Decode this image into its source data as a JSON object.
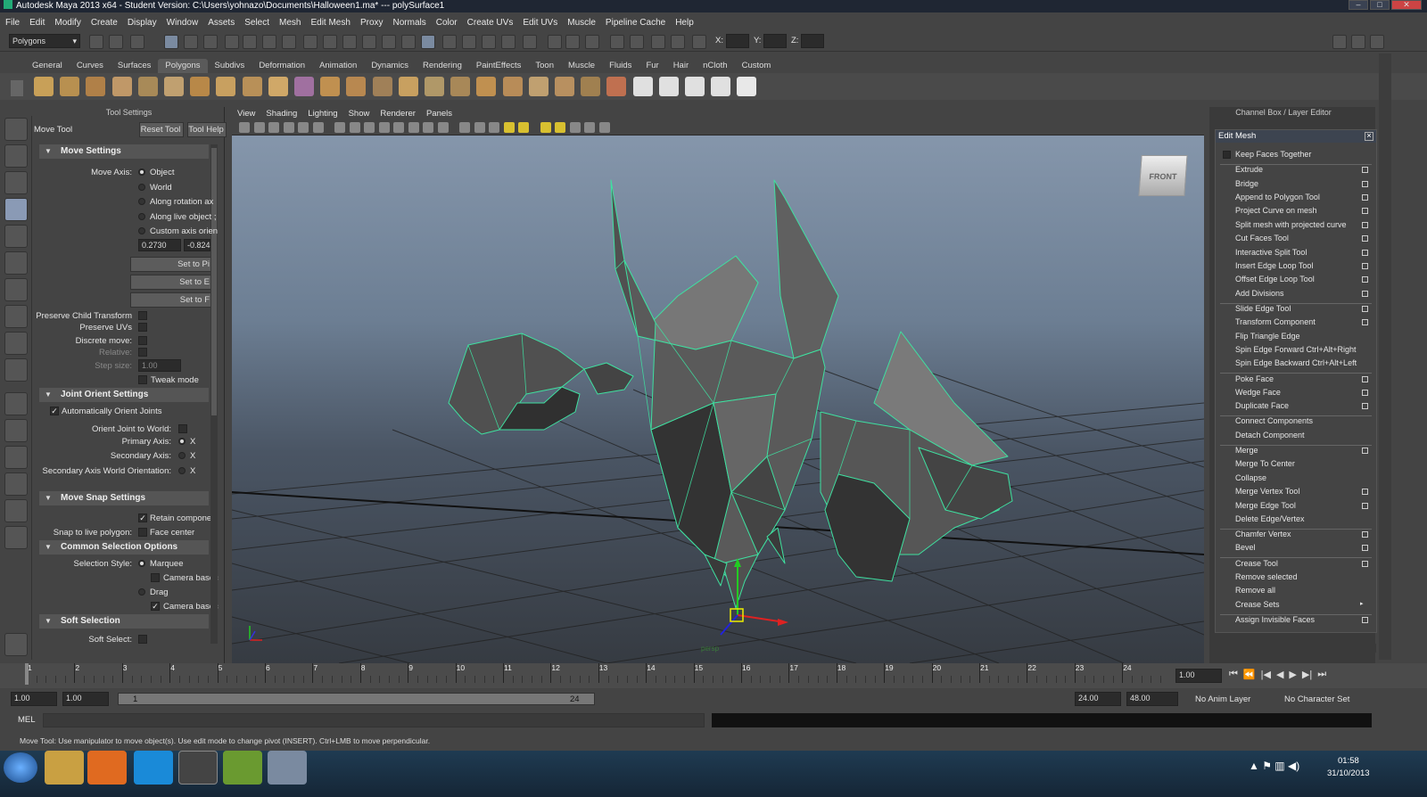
{
  "window": {
    "title": "Autodesk Maya 2013 x64 - Student Version: C:\\Users\\yohnazo\\Documents\\Halloween1.ma*   ---   polySurface1"
  },
  "menubar": [
    "File",
    "Edit",
    "Modify",
    "Create",
    "Display",
    "Window",
    "Assets",
    "Select",
    "Mesh",
    "Edit Mesh",
    "Proxy",
    "Normals",
    "Color",
    "Create UVs",
    "Edit UVs",
    "Muscle",
    "Pipeline Cache",
    "Help"
  ],
  "status": {
    "mode": "Polygons",
    "x_label": "X:",
    "y_label": "Y:",
    "z_label": "Z:"
  },
  "shelf_tabs": [
    "General",
    "Curves",
    "Surfaces",
    "Polygons",
    "Subdivs",
    "Deformation",
    "Animation",
    "Dynamics",
    "Rendering",
    "PaintEffects",
    "Toon",
    "Muscle",
    "Fluids",
    "Fur",
    "Hair",
    "nCloth",
    "Custom"
  ],
  "shelf_active": "Polygons",
  "tool_settings": {
    "panel_title": "Tool Settings",
    "tool_name": "Move Tool",
    "reset_label": "Reset Tool",
    "help_label": "Tool Help",
    "move_settings": "Move Settings",
    "move_axis_label": "Move Axis:",
    "axis_options": [
      "Object",
      "World",
      "Along rotation ax",
      "Along live object ;",
      "Custom axis orien"
    ],
    "field1": "0.2730",
    "field2": "-0.824",
    "set_buttons": [
      "Set to Pi",
      "Set to E",
      "Set to F"
    ],
    "preserve_child": "Preserve Child Transform",
    "preserve_uvs": "Preserve UVs",
    "discrete_move": "Discrete move:",
    "relative": "Relative:",
    "step_size": "Step size:",
    "step_value": "1.00",
    "tweak_mode": "Tweak mode",
    "joint_orient": "Joint Orient Settings",
    "auto_orient": "Automatically Orient Joints",
    "orient_world": "Orient Joint to World:",
    "primary_axis": "Primary Axis:",
    "secondary_axis": "Secondary Axis:",
    "secondary_world": "Secondary Axis World Orientation:",
    "axis_x": "X",
    "move_snap": "Move Snap Settings",
    "retain": "Retain componen",
    "snap_live": "Snap to live polygon:",
    "face_center": "Face center",
    "common_sel": "Common Selection Options",
    "selection_style": "Selection Style:",
    "marquee": "Marquee",
    "camera_based1": "Camera basec",
    "drag": "Drag",
    "camera_based2": "Camera basec",
    "soft_selection": "Soft Selection",
    "soft_select": "Soft Select:"
  },
  "viewport": {
    "menus": [
      "View",
      "Shading",
      "Lighting",
      "Show",
      "Renderer",
      "Panels"
    ],
    "viewcube": "FRONT",
    "camera": "persp"
  },
  "channel_box": {
    "title": "Channel Box / Layer Editor"
  },
  "edit_mesh": {
    "title": "Edit Mesh",
    "items": [
      {
        "label": "Keep Faces Together",
        "box": false,
        "sep_after": false,
        "checked": true
      },
      {
        "label": "Extrude",
        "box": true
      },
      {
        "label": "Bridge",
        "box": true
      },
      {
        "label": "Append to Polygon Tool",
        "box": true
      },
      {
        "label": "Project Curve on mesh",
        "box": true
      },
      {
        "label": "Split mesh with projected curve",
        "box": true
      },
      {
        "label": "Cut Faces Tool",
        "box": true
      },
      {
        "label": "Interactive Split Tool",
        "box": true
      },
      {
        "label": "Insert Edge Loop Tool",
        "box": true
      },
      {
        "label": "Offset Edge Loop Tool",
        "box": true
      },
      {
        "label": "Add Divisions",
        "box": true
      },
      {
        "label": "Slide Edge Tool",
        "box": true
      },
      {
        "label": "Transform Component",
        "box": true
      },
      {
        "label": "Flip Triangle Edge",
        "box": false
      },
      {
        "label": "Spin Edge Forward  Ctrl+Alt+Right",
        "box": false
      },
      {
        "label": "Spin Edge Backward  Ctrl+Alt+Left",
        "box": false
      },
      {
        "label": "Poke Face",
        "box": true
      },
      {
        "label": "Wedge Face",
        "box": true
      },
      {
        "label": "Duplicate Face",
        "box": true
      },
      {
        "label": "Connect Components",
        "box": false
      },
      {
        "label": "Detach Component",
        "box": false
      },
      {
        "label": "Merge",
        "box": true
      },
      {
        "label": "Merge To Center",
        "box": false
      },
      {
        "label": "Collapse",
        "box": false
      },
      {
        "label": "Merge Vertex Tool",
        "box": true
      },
      {
        "label": "Merge Edge Tool",
        "box": true
      },
      {
        "label": "Delete Edge/Vertex",
        "box": false
      },
      {
        "label": "Chamfer Vertex",
        "box": true
      },
      {
        "label": "Bevel",
        "box": true
      },
      {
        "label": "Crease Tool",
        "box": true
      },
      {
        "label": "Remove selected",
        "box": false
      },
      {
        "label": "Remove all",
        "box": false
      },
      {
        "label": "Crease Sets",
        "box": false,
        "arrow": true
      },
      {
        "label": "Assign Invisible Faces",
        "box": true
      }
    ]
  },
  "timeline": {
    "ticks": [
      "1",
      "2",
      "3",
      "4",
      "5",
      "6",
      "7",
      "8",
      "9",
      "10",
      "11",
      "12",
      "13",
      "14",
      "15",
      "16",
      "17",
      "18",
      "19",
      "20",
      "21",
      "22",
      "23",
      "24"
    ],
    "current": "1.00"
  },
  "range": {
    "start": "1.00",
    "start2": "1.00",
    "inner_start": "1",
    "inner_end": "24",
    "end": "24.00",
    "end2": "48.00",
    "anim_layer": "No Anim Layer",
    "char_set": "No Character Set"
  },
  "command": {
    "label": "MEL"
  },
  "help_line": "Move Tool: Use manipulator to move object(s). Use edit mode to change pivot (INSERT). Ctrl+LMB to move perpendicular.",
  "taskbar": {
    "time": "01:58",
    "date": "31/10/2013"
  },
  "colors": {
    "wire": "#3fe0a0",
    "mesh": "#5c5c5c",
    "accent": "#7a8aa0"
  }
}
